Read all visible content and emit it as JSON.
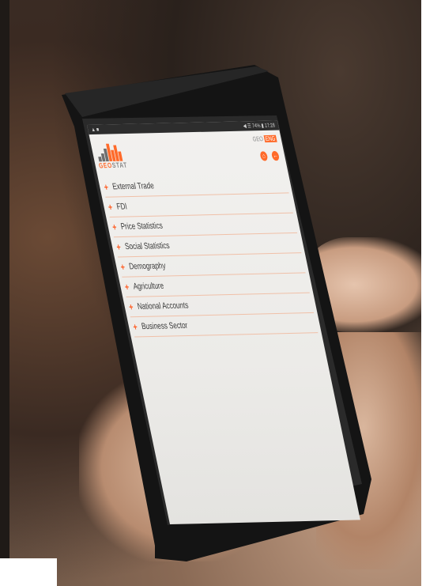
{
  "brand": {
    "logo_geo": "GEO",
    "logo_stat": "STAT",
    "lang_geo": "GEO",
    "lang_eng": "ENG",
    "accent_color": "#ff6a2a"
  },
  "status_bar": {
    "left": "▲ ■",
    "right": "◀ ☰ 74% ▮ 17:28"
  },
  "header_icons": [
    "home-icon",
    "back-icon"
  ],
  "menu": {
    "items": [
      {
        "label": "External Trade"
      },
      {
        "label": "FDI"
      },
      {
        "label": "Price Statistics"
      },
      {
        "label": "Social Statistics"
      },
      {
        "label": "Demography"
      },
      {
        "label": "Agriculture"
      },
      {
        "label": "National Accounts"
      },
      {
        "label": "Business Sector"
      }
    ]
  }
}
